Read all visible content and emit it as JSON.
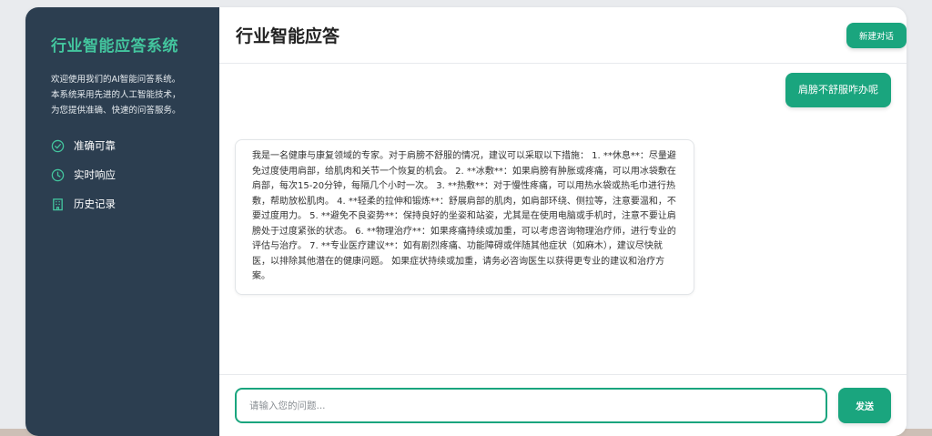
{
  "sidebar": {
    "title": "行业智能应答系统",
    "description": [
      "欢迎使用我们的AI智能问答系统。",
      "本系统采用先进的人工智能技术，",
      "为您提供准确、快速的问答服务。"
    ],
    "features": [
      {
        "icon": "check-circle-icon",
        "label": "准确可靠"
      },
      {
        "icon": "clock-icon",
        "label": "实时响应"
      },
      {
        "icon": "building-icon",
        "label": "历史记录"
      }
    ]
  },
  "header": {
    "title": "行业智能应答",
    "new_chat_label": "新建对话"
  },
  "chat": {
    "user_message": "肩膀不舒服咋办呢",
    "bot_message": "我是一名健康与康复领域的专家。对于肩膀不舒服的情况，建议可以采取以下措施： 1. **休息**：尽量避免过度使用肩部，给肌肉和关节一个恢复的机会。 2. **冰敷**：如果肩膀有肿胀或疼痛，可以用冰袋敷在肩部，每次15-20分钟，每隔几个小时一次。 3. **热敷**：对于慢性疼痛，可以用热水袋或热毛巾进行热敷，帮助放松肌肉。 4. **轻柔的拉伸和锻炼**：舒展肩部的肌肉，如肩部环绕、侧拉等，注意要温和，不要过度用力。 5. **避免不良姿势**：保持良好的坐姿和站姿，尤其是在使用电脑或手机时，注意不要让肩膀处于过度紧张的状态。 6. **物理治疗**：如果疼痛持续或加重，可以考虑咨询物理治疗师，进行专业的评估与治疗。 7. **专业医疗建议**：如有剧烈疼痛、功能障碍或伴随其他症状（如麻木），建议尽快就医，以排除其他潜在的健康问题。 如果症状持续或加重，请务必咨询医生以获得更专业的建议和治疗方案。"
  },
  "input": {
    "placeholder": "请输入您的问题...",
    "value": "",
    "send_label": "发送"
  },
  "colors": {
    "accent": "#1aa57e",
    "sidebar_bg": "#2c3e50",
    "sidebar_title": "#43c59e"
  }
}
